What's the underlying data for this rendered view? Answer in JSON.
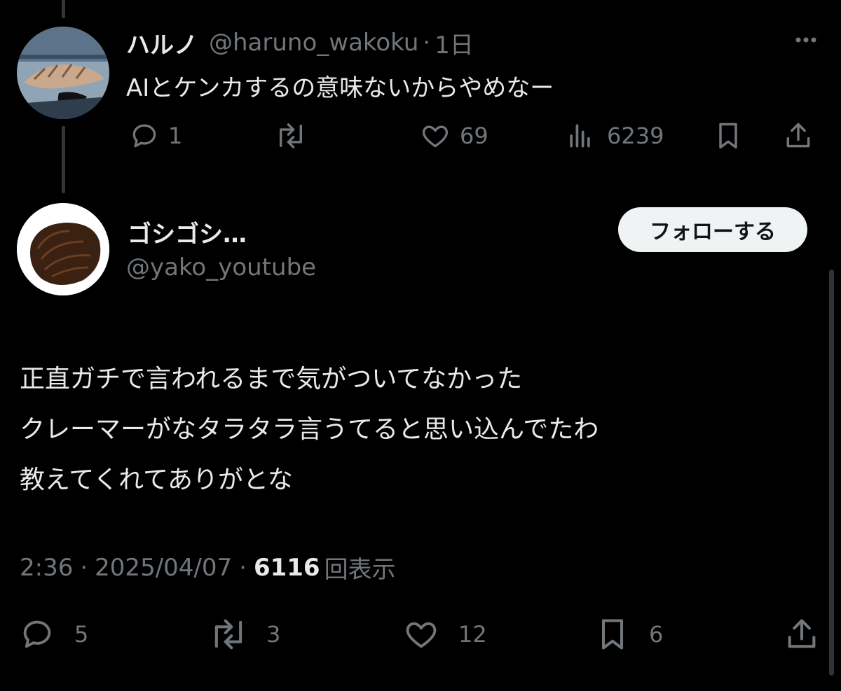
{
  "reply": {
    "display_name": "ハルノ",
    "handle": "@haruno_wakoku",
    "separator": "·",
    "time": "1日",
    "text": "AIとケンカするの意味ないからやめなー",
    "more": "···",
    "metrics": {
      "replies": "1",
      "likes": "69",
      "views": "6239"
    }
  },
  "main": {
    "display_name": "ゴシゴシ…",
    "handle": "@yako_youtube",
    "follow_label": "フォローする",
    "text_lines": [
      "正直ガチで言われるまで気がついてなかった",
      "クレーマーがなタラタラ言うてると思い込んでたわ",
      "教えてくれてありがとな"
    ],
    "time": "2:36",
    "sep1": "·",
    "date": "2025/04/07",
    "sep2": "·",
    "views": "6116",
    "views_label": "回表示",
    "metrics": {
      "replies": "5",
      "reposts": "3",
      "likes": "12",
      "bookmarks": "6"
    }
  },
  "icons": [
    "reply-icon",
    "repost-icon",
    "like-icon",
    "views-icon",
    "bookmark-icon",
    "share-icon",
    "more-icon"
  ],
  "colors": {
    "background": "#000000",
    "text": "#e7e9ea",
    "muted": "#71767b",
    "button": "#eff3f4"
  }
}
